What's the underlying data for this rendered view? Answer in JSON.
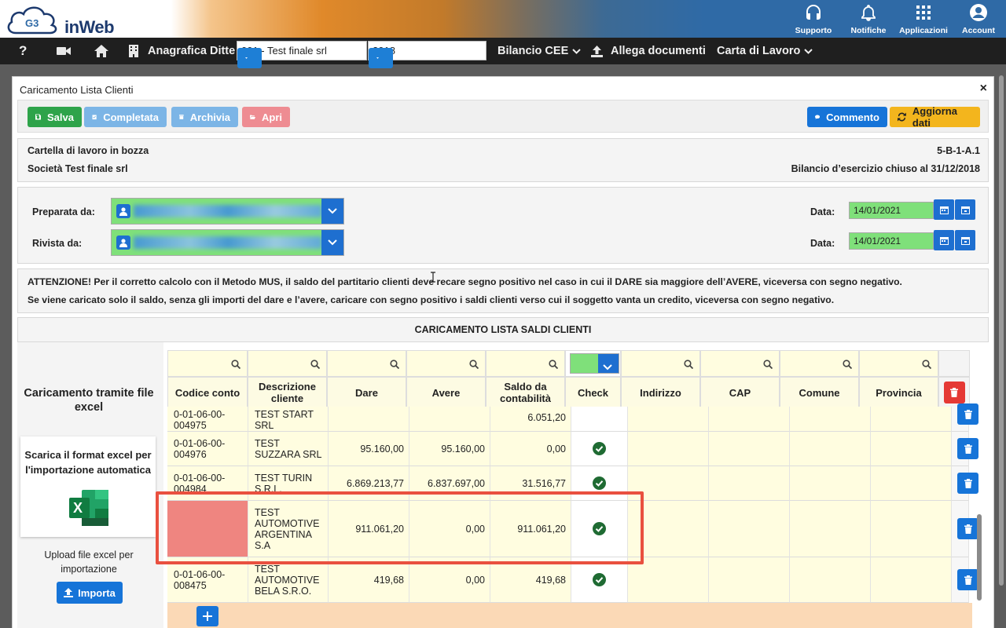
{
  "header": {
    "logo_text": "inWeb",
    "logo_badge": "G3",
    "actions": [
      {
        "label": "Supporto",
        "icon": "headset-icon"
      },
      {
        "label": "Notifiche",
        "icon": "bell-icon"
      },
      {
        "label": "Applicazioni",
        "icon": "apps-grid-icon"
      },
      {
        "label": "Account",
        "icon": "account-icon"
      }
    ]
  },
  "navbar": {
    "help": "?",
    "company_label": "Anagrafica Ditte",
    "company_select": "001 - Test finale srl",
    "year_select": "2018",
    "bilancio": "Bilancio CEE",
    "allega": "Allega documenti",
    "carta": "Carta di Lavoro"
  },
  "modal": {
    "title": "Caricamento Lista Clienti",
    "close": "×",
    "toolbar": {
      "save": "Salva",
      "completed": "Completata",
      "archive": "Archivia",
      "open": "Apri",
      "comment": "Commento",
      "refresh": "Aggiorna dati"
    },
    "info": {
      "status": "Cartella di lavoro in bozza",
      "code": "5-B-1-A.1",
      "company": "Società Test finale srl",
      "period": "Bilancio d’esercizio chiuso al 31/12/2018"
    },
    "form": {
      "prepared_label": "Preparata da:",
      "reviewed_label": "Rivista da:",
      "date_label": "Data:",
      "prepared_date": "14/01/2021",
      "reviewed_date": "14/01/2021"
    },
    "warning": {
      "line1": "ATTENZIONE! Per il corretto calcolo con il Metodo MUS, il saldo del partitario clienti deve recare segno positivo nel caso in cui il DARE sia maggiore dell’AVERE, viceversa con segno negativo.",
      "line2": "Se viene caricato solo il saldo, senza gli importi del dare e l’avere, caricare con segno positivo i saldi clienti verso cui il soggetto vanta un credito, viceversa con segno negativo."
    },
    "section_title": "CARICAMENTO LISTA SALDI CLIENTI",
    "left_panel": {
      "title": "Caricamento tramite file excel",
      "download": "Scarica il format excel per l'importazione automatica",
      "upload": "Upload file excel per importazione",
      "import": "Importa"
    },
    "grid": {
      "columns": [
        "Codice conto",
        "Descrizione cliente",
        "Dare",
        "Avere",
        "Saldo da contabilità",
        "Check",
        "Indirizzo",
        "CAP",
        "Comune",
        "Provincia"
      ],
      "rows": [
        {
          "code": "0-01-06-00-004975",
          "desc": "TEST START SRL",
          "dare": "",
          "avere": "",
          "saldo": "6.051,20",
          "check": true
        },
        {
          "code": "0-01-06-00-004976",
          "desc": "TEST SUZZARA SRL",
          "dare": "95.160,00",
          "avere": "95.160,00",
          "saldo": "0,00",
          "check": true
        },
        {
          "code": "0-01-06-00-004984",
          "desc": "TEST TURIN S.R.L.",
          "dare": "6.869.213,77",
          "avere": "6.837.697,00",
          "saldo": "31.516,77",
          "check": true
        },
        {
          "code": "",
          "desc": "TEST AUTOMOTIVE ARGENTINA S.A",
          "dare": "911.061,20",
          "avere": "0,00",
          "saldo": "911.061,20",
          "check": true
        },
        {
          "code": "0-01-06-00-008475",
          "desc": "TEST AUTOMOTIVE BELA S.R.O.",
          "dare": "419,68",
          "avere": "0,00",
          "saldo": "419,68",
          "check": true
        }
      ]
    }
  },
  "colors": {
    "accent_blue": "#1674d8",
    "green": "#2ea34a",
    "missing_code": "#ef8580",
    "highlight": "#e9503f"
  }
}
